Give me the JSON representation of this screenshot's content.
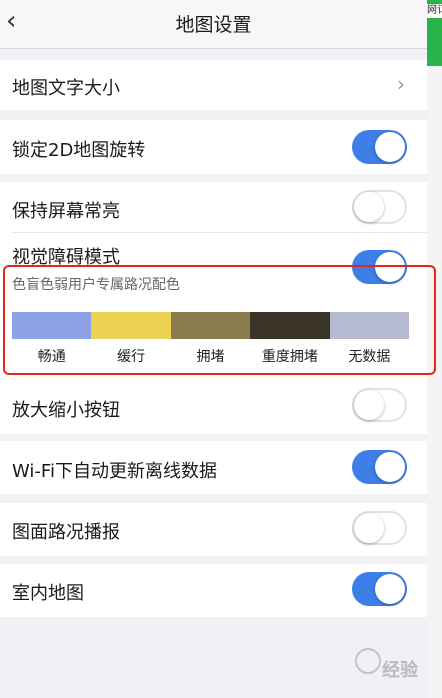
{
  "header": {
    "title": "地图设置",
    "back_icon": "chevron-left-icon"
  },
  "right_strip": {
    "text": "网订"
  },
  "settings": {
    "font_size": {
      "label": "地图文字大小"
    },
    "lock_2d": {
      "label": "锁定2D地图旋转",
      "on": true
    },
    "keep_screen_on": {
      "label": "保持屏幕常亮",
      "on": false
    },
    "accessibility": {
      "label": "视觉障碍模式",
      "on": true,
      "subtitle": "色盲色弱用户专属路况配色",
      "palette": [
        {
          "label": "畅通",
          "color": "#8ea3e6"
        },
        {
          "label": "缓行",
          "color": "#ecd356"
        },
        {
          "label": "拥堵",
          "color": "#8b7c4d"
        },
        {
          "label": "重度拥堵",
          "color": "#3a3328"
        },
        {
          "label": "无数据",
          "color": "#b6bad1"
        }
      ]
    },
    "zoom_buttons": {
      "label": "放大缩小按钮",
      "on": false
    },
    "wifi_update": {
      "label": "Wi-Fi下自动更新离线数据",
      "on": true
    },
    "traffic_broadcast": {
      "label": "图面路况播报",
      "on": false
    },
    "indoor_map": {
      "label": "室内地图",
      "on": true
    }
  },
  "watermark": {
    "text": "经验"
  },
  "colors": {
    "toggle_on": "#3d7fe6",
    "highlight": "#e4261d",
    "background": "#f0f0f5"
  }
}
